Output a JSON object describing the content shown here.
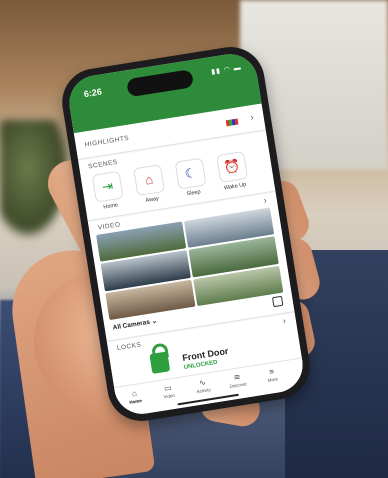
{
  "status_bar": {
    "time": "6:26"
  },
  "sections": {
    "highlights": {
      "title": "HIGHLIGHTS"
    },
    "scenes": {
      "title": "SCENES",
      "items": [
        {
          "label": "Home",
          "icon": "home-arrow-icon",
          "color": "#2e9e3e"
        },
        {
          "label": "Away",
          "icon": "away-house-icon",
          "color": "#d03030"
        },
        {
          "label": "Sleep",
          "icon": "moon-icon",
          "color": "#2a3f9a"
        },
        {
          "label": "Wake Up",
          "icon": "alarm-clock-icon",
          "color": "#e0b000"
        }
      ]
    },
    "video": {
      "title": "VIDEO",
      "camera_select": "All Cameras"
    },
    "locks": {
      "title": "LOCKS",
      "lock_name": "Front Door",
      "lock_status": "UNLOCKED"
    }
  },
  "tabs": [
    {
      "label": "Home",
      "icon": "home-icon",
      "active": true
    },
    {
      "label": "Video",
      "icon": "video-icon",
      "active": false
    },
    {
      "label": "Activity",
      "icon": "activity-icon",
      "active": false
    },
    {
      "label": "Discover",
      "icon": "discover-icon",
      "active": false
    },
    {
      "label": "More",
      "icon": "menu-icon",
      "active": false
    }
  ],
  "colors": {
    "brand_green": "#2e8b3a",
    "unlocked_green": "#2e9e3e"
  }
}
